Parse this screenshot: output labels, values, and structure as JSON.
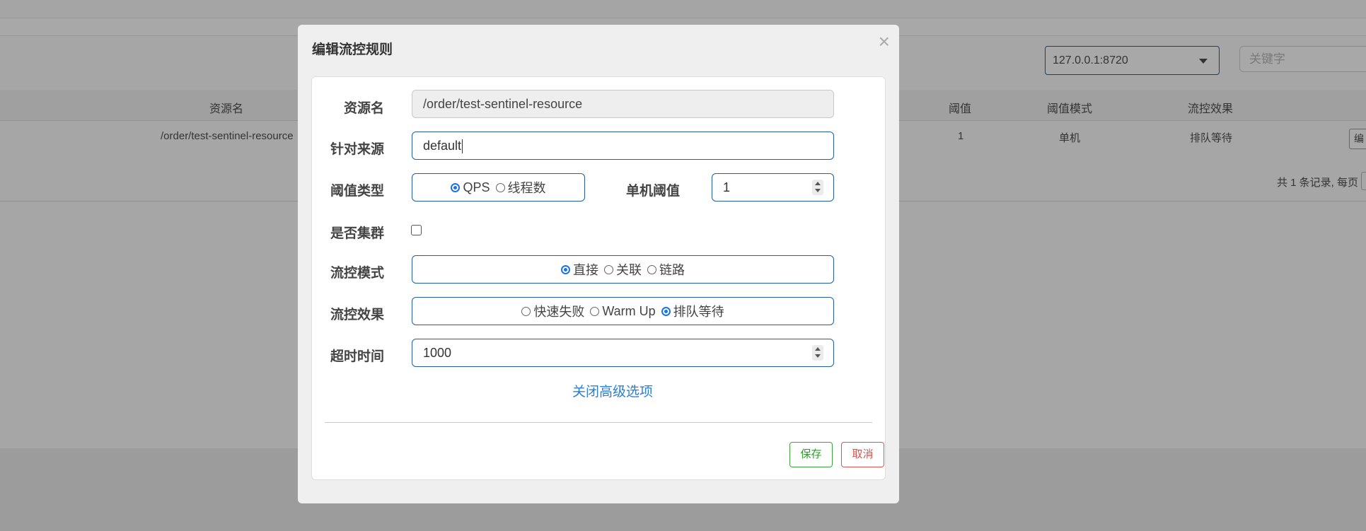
{
  "background": {
    "ip_select": "127.0.0.1:8720",
    "search_placeholder": "关键字",
    "table": {
      "headers": [
        "资源名",
        "阈值",
        "阈值模式",
        "流控效果"
      ],
      "row": {
        "resource": "/order/test-sentinel-resource",
        "threshold": "1",
        "mode": "单机",
        "effect": "排队等待",
        "edit_button": "编"
      }
    },
    "pagination": "共 1 条记录, 每页"
  },
  "modal": {
    "title": "编辑流控规则",
    "close_glyph": "×",
    "fields": {
      "resource": {
        "label": "资源名",
        "value": "/order/test-sentinel-resource"
      },
      "origin": {
        "label": "针对来源",
        "value": "default"
      },
      "threshold_type": {
        "label": "阈值类型",
        "options": [
          "QPS",
          "线程数"
        ],
        "selected": "QPS"
      },
      "single_threshold": {
        "label": "单机阈值",
        "value": "1"
      },
      "cluster": {
        "label": "是否集群",
        "checked": false
      },
      "flow_mode": {
        "label": "流控模式",
        "options": [
          "直接",
          "关联",
          "链路"
        ],
        "selected": "直接"
      },
      "flow_effect": {
        "label": "流控效果",
        "options": [
          "快速失败",
          "Warm Up",
          "排队等待"
        ],
        "selected": "排队等待"
      },
      "timeout": {
        "label": "超时时间",
        "value": "1000"
      }
    },
    "advanced_link": "关闭高级选项",
    "save_button": "保存",
    "cancel_button": "取消"
  },
  "colors": {
    "primary_border": "#1f5fa8",
    "radio_checked": "#1a73e8",
    "save": "#2d9a2d",
    "cancel": "#d9534f",
    "link": "#2a7fd4"
  }
}
